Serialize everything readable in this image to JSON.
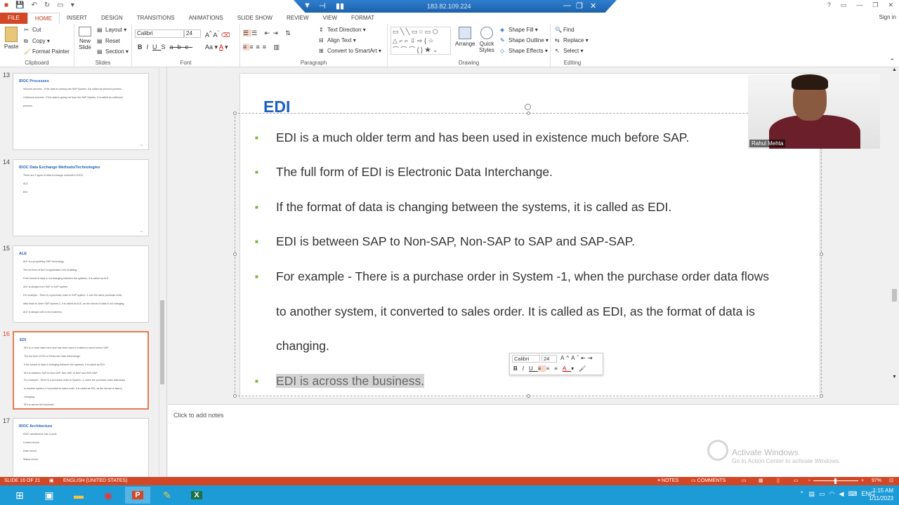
{
  "titlebar": {
    "remote_ip": "183.82.109.224",
    "help": "?",
    "signin": "Sign in"
  },
  "tabs": [
    "FILE",
    "HOME",
    "INSERT",
    "DESIGN",
    "TRANSITIONS",
    "ANIMATIONS",
    "SLIDE SHOW",
    "REVIEW",
    "VIEW",
    "FORMAT"
  ],
  "ribbon": {
    "clipboard": {
      "label": "Clipboard",
      "paste": "Paste",
      "cut": "Cut",
      "copy": "Copy",
      "format_painter": "Format Painter"
    },
    "slides": {
      "label": "Slides",
      "new_slide": "New Slide",
      "layout": "Layout",
      "reset": "Reset",
      "section": "Section"
    },
    "font": {
      "label": "Font",
      "family": "Calibri",
      "size": "24"
    },
    "paragraph": {
      "label": "Paragraph",
      "text_direction": "Text Direction",
      "align_text": "Align Text",
      "convert": "Convert to SmartArt"
    },
    "drawing": {
      "label": "Drawing",
      "arrange": "Arrange",
      "quick_styles": "Quick Styles",
      "fill": "Shape Fill",
      "outline": "Shape Outline",
      "effects": "Shape Effects"
    },
    "editing": {
      "label": "Editing",
      "find": "Find",
      "replace": "Replace",
      "select": "Select"
    }
  },
  "thumbnails": [
    {
      "num": "13",
      "title": "IDOC Processes",
      "lines": [
        "Inbound process - If the data is coming into SAP System, it is called as inbound process.",
        "Outbound process - If the data is going out from the SAP System, it is called as outbound",
        "process."
      ]
    },
    {
      "num": "14",
      "title": "IDOC Data Exchange Methods/Technologies",
      "lines": [
        "There are 2 types of data exchange methods in IDOC.",
        "ALE",
        "EDI"
      ]
    },
    {
      "num": "15",
      "title": "ALE",
      "lines": [
        "ALE is a proprietary SAP technology.",
        "The full form of ALE is Application Link Enabling.",
        "If the format of data is not changing between the systems, it is called as ALE.",
        "ALE is always from SAP to SAP system.",
        "For example - There is a purchase order in SAP system -1 and the same purchase order",
        "data flows to other SAP system-2, it is called as ALE, as the format of data is not changing.",
        "ALE is always with in the business."
      ]
    },
    {
      "num": "16",
      "title": "EDI",
      "lines": [
        "EDI is a much older term and has been used in existence much before SAP.",
        "The full form of EDI is Electronic Data Interchange.",
        "If the format of data is changing between the systems, it is called as EDI.",
        "EDI is between SAP to Non-SAP, Non-SAP to SAP and SAP-SAP.",
        "For example - There is a purchase order in System -1, when the purchase order data flows",
        "to another system, it converted to sales order. It is called as EDI, as the format of data is",
        "changing.",
        "EDI is across the business."
      ]
    },
    {
      "num": "17",
      "title": "IDOC Architecture",
      "lines": [
        "IDOC architecture has 3 parts",
        "Control record",
        "Data record",
        "Status record"
      ]
    }
  ],
  "slide": {
    "title": "EDI",
    "bullets": [
      "EDI is a much older term and has been used in existence much before SAP.",
      "The full form of EDI is Electronic Data Interchange.",
      "If the format of data is changing between the systems, it is called as EDI.",
      "EDI is between SAP to Non-SAP, Non-SAP to SAP and SAP-SAP.",
      "For example - There is a purchase order in System -1, when the purchase order data flows",
      "to another system, it converted to sales order. It is called as EDI, as the format of data is",
      "changing.",
      "EDI is across the business."
    ],
    "number": "16"
  },
  "mini_toolbar": {
    "font": "Calibri",
    "size": "24"
  },
  "webcam": {
    "name": "Rahul Mehta"
  },
  "notes": {
    "placeholder": "Click to add notes"
  },
  "watermark": {
    "title": "Activate Windows",
    "subtitle": "Go to Action Center to activate Windows."
  },
  "status": {
    "slide": "SLIDE 16 OF 21",
    "lang": "ENGLISH (UNITED STATES)",
    "notes": "NOTES",
    "comments": "COMMENTS",
    "zoom": "97%"
  },
  "taskbar": {
    "lang": "ENG",
    "time": "1:15 AM",
    "date": "1/11/2023"
  },
  "colors": {
    "accent": "#d24726",
    "title_blue": "#1f5fbf",
    "bullet_green": "#7cb342",
    "taskbar": "#1c9bd7"
  }
}
